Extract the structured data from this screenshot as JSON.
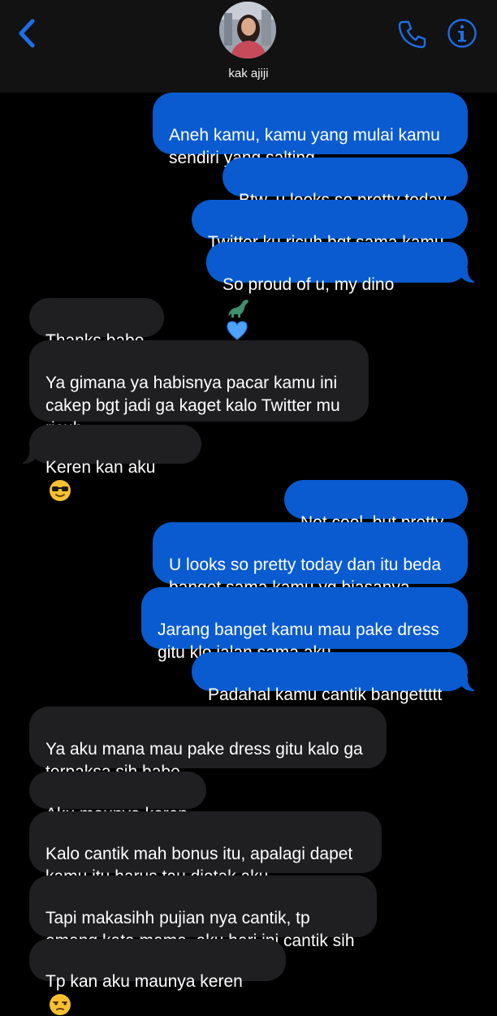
{
  "header": {
    "contact_name": "kak ajiji"
  },
  "colors": {
    "accent": "#0a5bd0",
    "icon_blue": "#1e6ee6",
    "received_bubble": "#1f1f21",
    "background": "#000000"
  },
  "messages": [
    {
      "side": "sent",
      "text": "Aneh kamu, kamu yang mulai kamu\nsendiri yang salting"
    },
    {
      "side": "sent",
      "text": "Btw, u looks so pretty today"
    },
    {
      "side": "sent",
      "text": "Twitter ku ricuh bgt sama kamu"
    },
    {
      "side": "sent",
      "text": "So proud of u, my dino",
      "emoji": [
        "dinosaur-emoji",
        "blue-heart-emoji"
      ]
    },
    {
      "side": "received",
      "text": "Thanks babe"
    },
    {
      "side": "received",
      "text": "Ya gimana ya habisnya pacar kamu ini\ncakep bgt jadi ga kaget kalo Twitter mu\nricuh"
    },
    {
      "side": "received",
      "text": "Keren kan aku",
      "emoji": [
        "sunglasses-emoji"
      ]
    },
    {
      "side": "sent",
      "text": "Not cool, but pretty"
    },
    {
      "side": "sent",
      "text": "U looks so pretty today dan itu beda\nbanget sama kamu yg biasanya"
    },
    {
      "side": "sent",
      "text": "Jarang banget kamu mau pake dress\ngitu klo jalan sama aku"
    },
    {
      "side": "sent",
      "text": "Padahal kamu cantik bangettttt"
    },
    {
      "side": "received",
      "text": "Ya aku mana mau pake dress gitu kalo ga\nterpaksa sih babe"
    },
    {
      "side": "received",
      "text": "Aku maunya keren"
    },
    {
      "side": "received",
      "text": "Kalo cantik mah bonus itu, apalagi dapet\nkamu itu harus tau diotak aku"
    },
    {
      "side": "received",
      "text": "Tapi makasihh pujian nya cantik, tp\nemang kata mama, aku hari ini cantik sih"
    },
    {
      "side": "received",
      "text": "Tp kan aku maunya keren",
      "emoji": [
        "unamused-face-emoji"
      ]
    }
  ]
}
